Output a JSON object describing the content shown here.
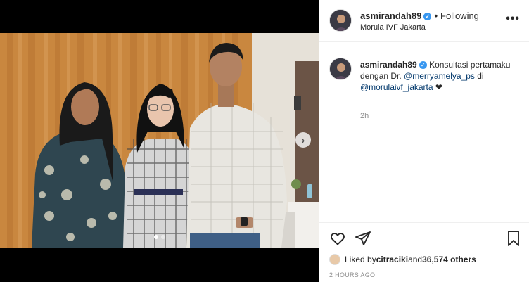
{
  "post": {
    "username": "asmirandah89",
    "separator": "•",
    "follow_state": "Following",
    "location": "Morula IVF Jakarta",
    "more_icon": "more-horizontal-icon",
    "verified_icon": "verified-badge-icon"
  },
  "caption": {
    "username": "asmirandah89",
    "text_before": "Konsultasi pertamaku dengan Dr. ",
    "mention1": "@merryamelya_ps",
    "text_middle": " di ",
    "mention2": "@morulaivf_jakarta",
    "emoji": "❤",
    "time": "2h"
  },
  "actions": {
    "like_icon": "heart-icon",
    "share_icon": "send-icon",
    "save_icon": "bookmark-icon"
  },
  "likes": {
    "prefix": "Liked by ",
    "user": "citraciki",
    "middle": " and ",
    "count": "36,574 others"
  },
  "post_time": "2 HOURS AGO",
  "carousel": {
    "total": 2,
    "active": 1,
    "next_icon": "chevron-right-icon"
  },
  "colors": {
    "link": "#00376b",
    "verified": "#3897f0",
    "muted": "#8e8e8e",
    "border": "#efefef"
  }
}
